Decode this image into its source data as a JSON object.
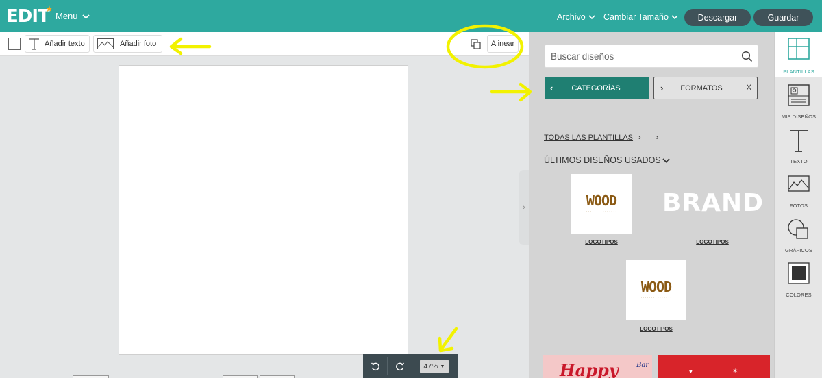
{
  "app": {
    "logo": "EDIT",
    "menu_label": "Menu"
  },
  "header": {
    "archivo_label": "Archivo",
    "cambiar_tamano_label": "Cambiar Tamaño",
    "descargar_label": "Descargar",
    "guardar_label": "Guardar"
  },
  "toolbar": {
    "add_text_label": "Añadir texto",
    "add_photo_label": "Añadir foto",
    "align_label": "Alinear"
  },
  "zoom": {
    "value": "47%"
  },
  "panel": {
    "search_placeholder": "Buscar diseños",
    "categories_label": "CATEGORÍAS",
    "formats_label": "FORMATOS",
    "formats_close": "X",
    "breadcrumb_root": "TODAS LAS PLANTILLAS",
    "recent_label": "ÚLTIMOS DISEÑOS USADOS",
    "templates": [
      {
        "title": "WOOD",
        "caption": "LOGOTIPOS"
      },
      {
        "title": "BRAND",
        "caption": "LOGOTIPOS"
      },
      {
        "title": "WOOD",
        "caption": "LOGOTIPOS"
      }
    ],
    "partial_cards": [
      {
        "text": "Happy",
        "badge": "Bar"
      }
    ]
  },
  "rail": {
    "items": [
      {
        "label": "PLANTILLAS",
        "icon": "templates-icon",
        "active": true
      },
      {
        "label": "MIS DISEÑOS",
        "icon": "my-designs-icon",
        "active": false
      },
      {
        "label": "TEXTO",
        "icon": "text-icon",
        "active": false
      },
      {
        "label": "FOTOS",
        "icon": "photos-icon",
        "active": false
      },
      {
        "label": "GRÁFICOS",
        "icon": "graphics-icon",
        "active": false
      },
      {
        "label": "COLORES",
        "icon": "colors-icon",
        "active": false
      }
    ]
  },
  "colors": {
    "header": "#2ea99f",
    "accent_button": "#1f7f72",
    "dark_pill": "#3f5259",
    "annotation": "#f2f200"
  }
}
